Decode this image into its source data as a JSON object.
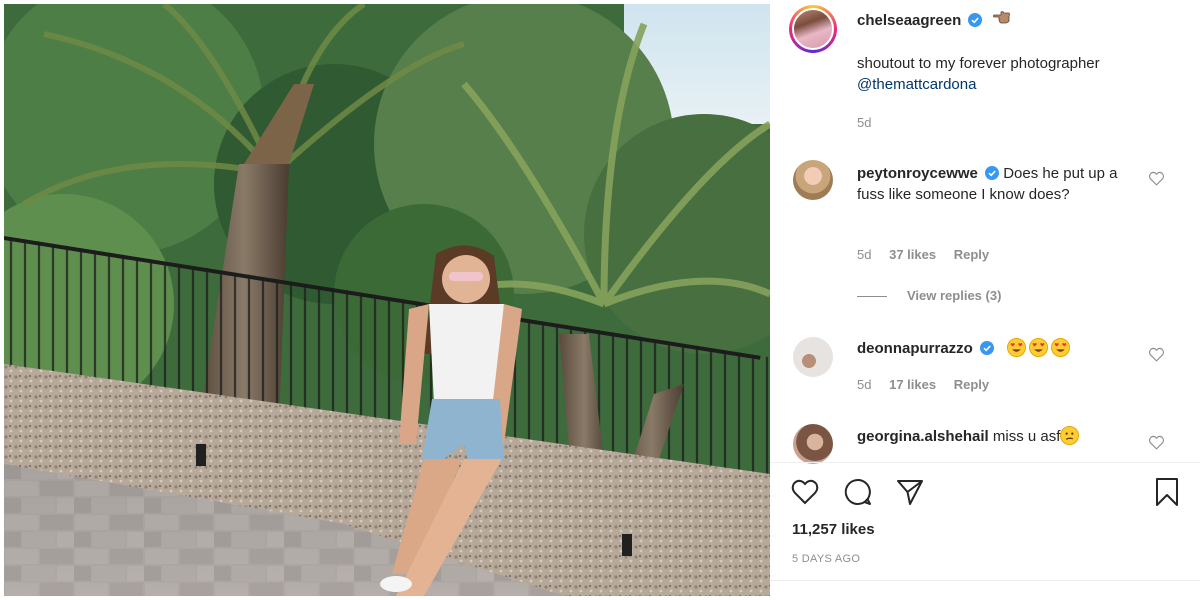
{
  "post": {
    "author": "chelseaagreen",
    "author_emoji": "hand-pointing-left",
    "caption_text": "shoutout to my forever photographer",
    "caption_mention": "@themattcardona",
    "caption_time": "5d"
  },
  "comments": [
    {
      "username": "peytonroycewwe",
      "verified": true,
      "text": "Does he put up a fuss like someone I know does?",
      "time": "5d",
      "likes": "37 likes",
      "reply": "Reply",
      "view_replies": "View replies (3)"
    },
    {
      "username": "deonnapurrazzo",
      "verified": true,
      "emojis": [
        "heart-eyes-emoji",
        "heart-eyes-emoji",
        "heart-eyes-emoji"
      ],
      "time": "5d",
      "likes": "17 likes",
      "reply": "Reply"
    },
    {
      "username": "georgina.alshehail",
      "verified": false,
      "text": "miss u asf",
      "emoji": "confused-face-emoji"
    }
  ],
  "actions": {
    "icons": [
      "heart-icon",
      "comment-icon",
      "share-icon",
      "bookmark-icon"
    ]
  },
  "likes_count": "11,257 likes",
  "posted_ago": "5 DAYS AGO",
  "colors": {
    "text": "#262626",
    "muted": "#8e8e8e",
    "mention": "#00376b",
    "verified": "#3897f0"
  }
}
